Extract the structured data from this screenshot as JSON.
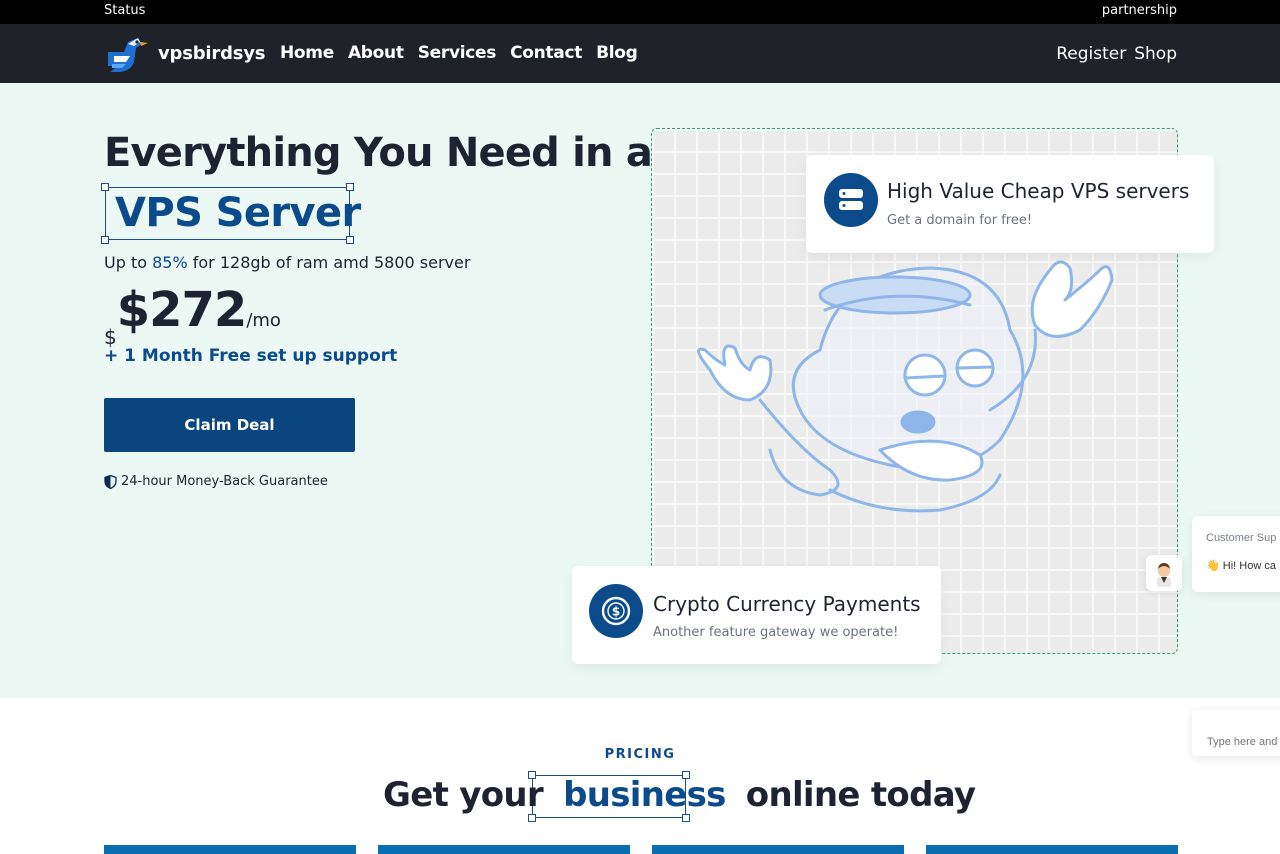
{
  "topbar": {
    "left_link": "Status",
    "right_link": "partnership"
  },
  "nav": {
    "brand": "vpsbirdsys",
    "menu": [
      "Home",
      "About",
      "Services",
      "Contact",
      "Blog"
    ],
    "register": "Register",
    "shop": "Shop"
  },
  "hero": {
    "headline_1": "Everything You Need in a",
    "headline_2": "VPS Server",
    "sub_prefix": "Up to ",
    "sub_percent": "85%",
    "sub_suffix": " for 128gb of ram amd 5800 server",
    "currency": "$",
    "price": "$272",
    "per": "/mo",
    "bonus": "+ 1 Month Free set up support",
    "cta": "Claim Deal",
    "guarantee": "24-hour Money-Back Guarantee"
  },
  "cards": {
    "vps": {
      "title": "High Value Cheap VPS servers",
      "desc": "Get a domain for free!",
      "icon": "server-icon"
    },
    "crypto": {
      "title": "Crypto Currency Payments",
      "desc": "Another feature gateway we operate!",
      "icon": "dollar-coin-icon"
    }
  },
  "chat": {
    "header": "Customer Sup",
    "greeting": "👋 Hi! How ca",
    "input_placeholder": "Type here and"
  },
  "pricing": {
    "label": "PRICING",
    "title_before": "Get your ",
    "title_highlight": "business",
    "title_after": " online today"
  },
  "colors": {
    "accent": "#0b4a8b",
    "button": "#0b4580",
    "hero_bg": "#ebf8f3",
    "nav_bg": "#1f2329",
    "dashed": "#2ba86c"
  }
}
